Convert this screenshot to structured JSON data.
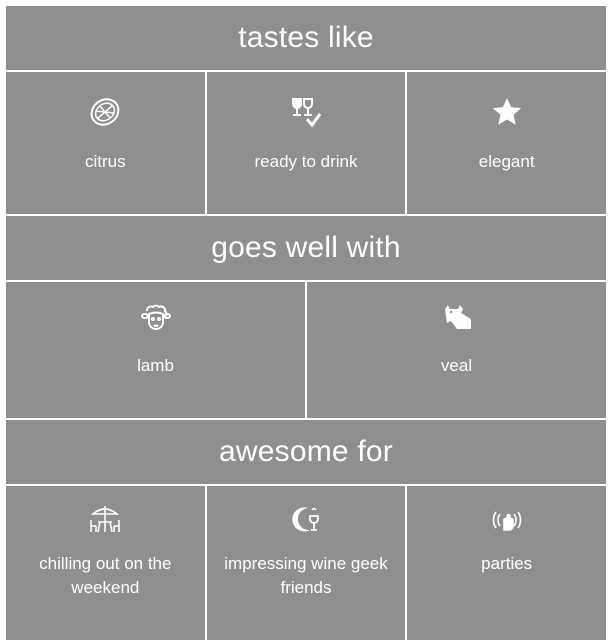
{
  "colors": {
    "tile": "#8f8f8f",
    "text": "#ffffff",
    "background": "#ffffff"
  },
  "sections": {
    "tastes": {
      "title": "tastes like",
      "items": [
        {
          "label": "citrus",
          "icon": "citrus-slice-icon"
        },
        {
          "label": "ready to drink",
          "icon": "wine-glasses-check-icon"
        },
        {
          "label": "elegant",
          "icon": "star-icon"
        }
      ]
    },
    "pairings": {
      "title": "goes well with",
      "items": [
        {
          "label": "lamb",
          "icon": "lamb-icon"
        },
        {
          "label": "veal",
          "icon": "cow-icon"
        }
      ]
    },
    "occasions": {
      "title": "awesome for",
      "items": [
        {
          "label": "chilling out on the weekend",
          "icon": "patio-umbrella-table-icon"
        },
        {
          "label": "impressing wine geek friends",
          "icon": "wine-geek-icon"
        },
        {
          "label": "parties",
          "icon": "party-hand-icon"
        }
      ]
    }
  }
}
